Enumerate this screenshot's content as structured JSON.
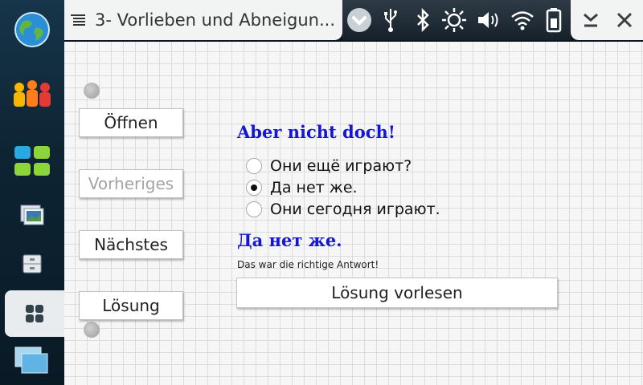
{
  "window": {
    "title": "3- Vorlieben und Abneigun..."
  },
  "dock": {
    "items": [
      {
        "icon": "globe-icon"
      },
      {
        "icon": "contacts-icon"
      },
      {
        "icon": "applications-icon"
      },
      {
        "icon": "photos-icon"
      },
      {
        "icon": "file-manager-icon"
      },
      {
        "icon": "dashboard-icon",
        "active": true
      },
      {
        "icon": "task-switcher-icon"
      }
    ]
  },
  "status_bar": {
    "icons": [
      "dropdown-icon",
      "usb-icon",
      "bluetooth-icon",
      "brightness-icon",
      "volume-icon",
      "wifi-icon",
      "battery-icon"
    ]
  },
  "side_buttons": {
    "open": "Öffnen",
    "previous": "Vorheriges",
    "next": "Nächstes",
    "solution": "Lösung"
  },
  "quiz": {
    "question": "Aber nicht doch!",
    "options": [
      "Они ещё играют?",
      "Да нет же.",
      "Они сегодня играют."
    ],
    "selected_index": 1,
    "answer": "Да нет же.",
    "feedback": "Das war die richtige Antwort!",
    "read_aloud_label": "Lösung vorlesen"
  },
  "colors": {
    "accent_text": "#1515d8",
    "disabled_text": "#a4a4a4"
  }
}
